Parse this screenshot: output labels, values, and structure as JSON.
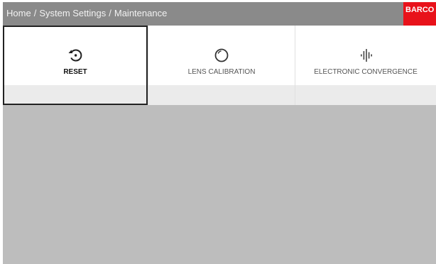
{
  "header": {
    "breadcrumb": [
      "Home",
      "System Settings",
      "Maintenance"
    ],
    "separator": "/",
    "logo": "BARCO"
  },
  "tiles": [
    {
      "label": "RESET",
      "icon": "reset-icon",
      "selected": true
    },
    {
      "label": "LENS CALIBRATION",
      "icon": "lens-calibration-icon",
      "selected": false
    },
    {
      "label": "ELECTRONIC CONVERGENCE",
      "icon": "electronic-convergence-icon",
      "selected": false
    }
  ],
  "colors": {
    "background": "#bdbdbd",
    "header": "#8a8a8a",
    "brand": "#e8121a"
  }
}
